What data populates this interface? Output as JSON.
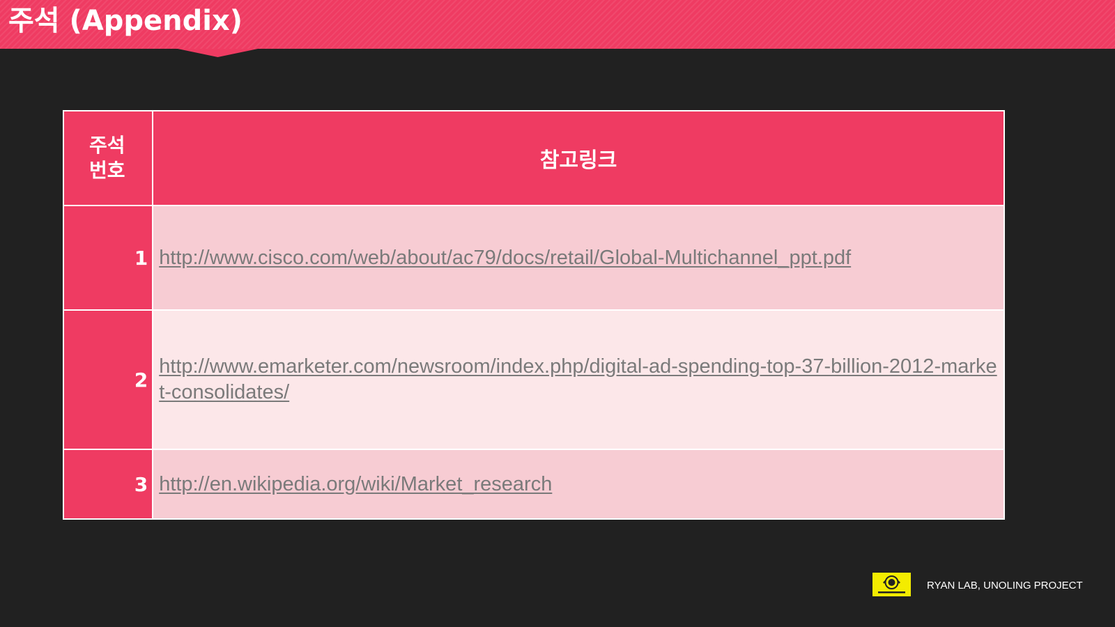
{
  "slide": {
    "title": "주석 (Appendix)"
  },
  "table": {
    "header": {
      "num_line1": "주석",
      "num_line2": "번호",
      "link": "참고링크"
    },
    "rows": [
      {
        "num": "1",
        "link": "http://www.cisco.com/web/about/ac79/docs/retail/Global-Multichannel_ppt.pdf"
      },
      {
        "num": "2",
        "link": "http://www.emarketer.com/newsroom/index.php/digital-ad-spending-top-37-billion-2012-market-consolidates/"
      },
      {
        "num": "3",
        "link": "http://en.wikipedia.org/wiki/Market_research"
      }
    ]
  },
  "footer": {
    "text": "RYAN LAB, UNOLING PROJECT",
    "logo_text": "RYAN LAB"
  },
  "colors": {
    "accent": "#ef3b62",
    "background": "#212121",
    "row_light": "#fce7e9",
    "row_mid": "#f7ccd3",
    "link": "#7a7a7a",
    "logo": "#f4ec00"
  }
}
